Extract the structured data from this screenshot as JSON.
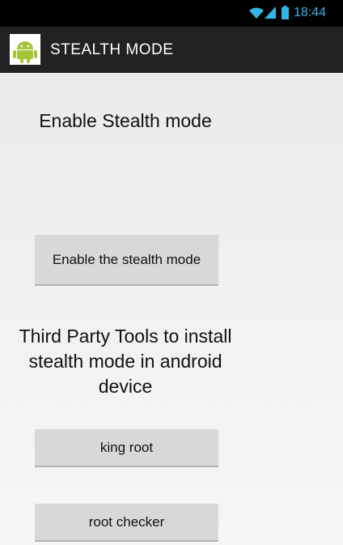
{
  "status_bar": {
    "time": "18:44",
    "wifi_icon": "wifi-icon",
    "signal_icon": "signal-icon",
    "battery_icon": "battery-icon",
    "accent_color": "#33b5e5"
  },
  "action_bar": {
    "title": "STEALTH MODE",
    "logo_icon": "android-icon",
    "logo_color": "#a4c639"
  },
  "main": {
    "heading": "Enable Stealth mode",
    "enable_button_label": "Enable the stealth mode",
    "tools_heading": "Third Party Tools to install stealth mode in android device",
    "king_root_label": "king root",
    "root_checker_label": "root checker"
  }
}
